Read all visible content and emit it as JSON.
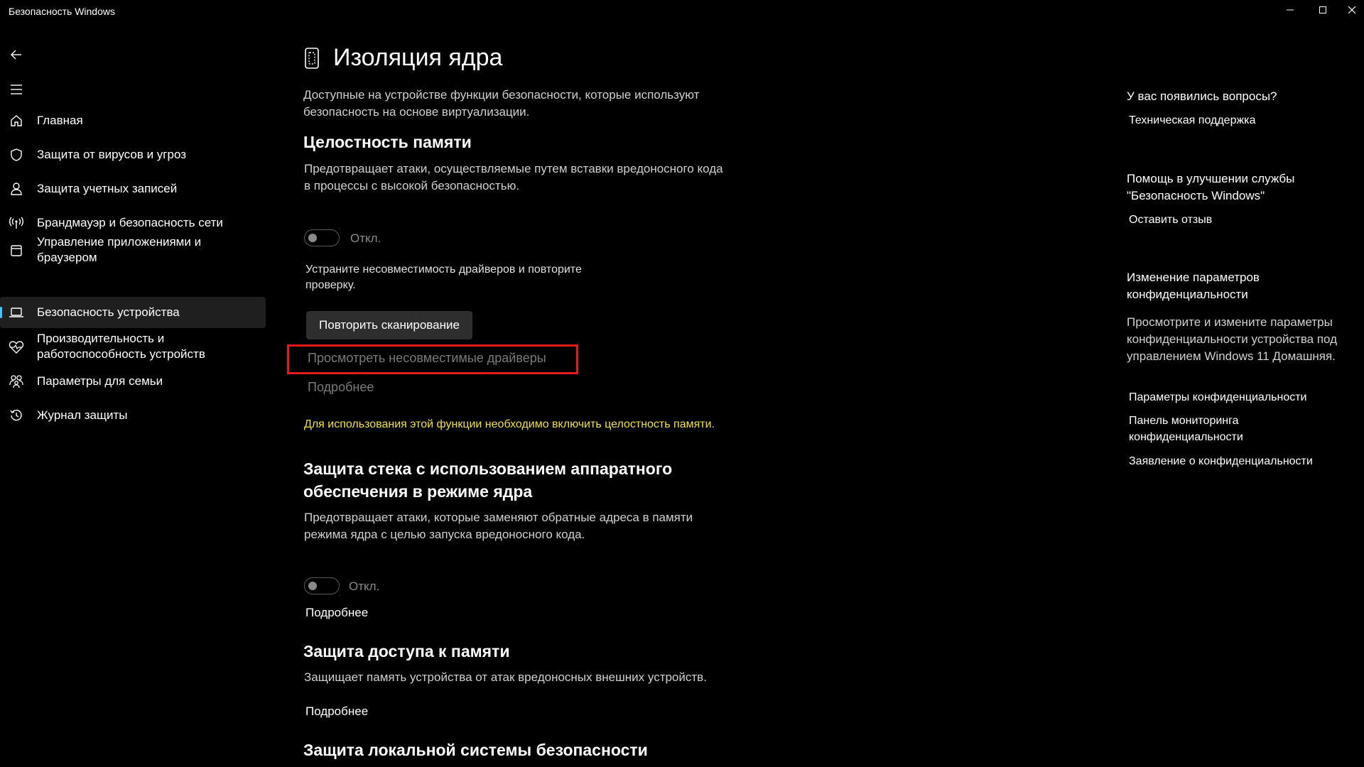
{
  "window": {
    "title": "Безопасность Windows",
    "minimize": "—",
    "maximize": "☐",
    "close": "✕"
  },
  "sidebar": {
    "items": [
      {
        "label": "Главная",
        "icon": "home-icon"
      },
      {
        "label": "Защита от вирусов и угроз",
        "icon": "shield-icon"
      },
      {
        "label": "Защита учетных записей",
        "icon": "person-icon"
      },
      {
        "label": "Брандмауэр и безопасность сети",
        "icon": "wifi-antenna-icon"
      },
      {
        "label": "Управление приложениями и браузером",
        "icon": "app-window-icon"
      },
      {
        "label": "Безопасность устройства",
        "icon": "laptop-icon",
        "active": true
      },
      {
        "label": "Производительность и работоспособность устройств",
        "icon": "heart-pulse-icon"
      },
      {
        "label": "Параметры для семьи",
        "icon": "family-icon"
      },
      {
        "label": "Журнал защиты",
        "icon": "history-icon"
      }
    ]
  },
  "main": {
    "title": "Изоляция ядра",
    "intro": "Доступные на устройстве функции безопасности, которые используют безопасность на основе виртуализации.",
    "memory_integrity": {
      "heading": "Целостность памяти",
      "description": "Предотвращает атаки, осуществляемые путем вставки вредоносного кода в процессы с высокой безопасностью.",
      "toggle_label": "Откл.",
      "fix_text": "Устраните несовместимость драйверов и повторите проверку.",
      "rescan_button": "Повторить сканирование",
      "view_drivers_link": "Просмотреть несовместимые драйверы",
      "more_link": "Подробнее"
    },
    "warning": "Для использования этой функции необходимо включить целостность памяти.",
    "stack_protection": {
      "heading": "Защита стека с использованием аппаратного обеспечения в режиме ядра",
      "description": "Предотвращает атаки, которые заменяют обратные адреса в памяти режима ядра с целью запуска вредоносного кода.",
      "toggle_label": "Откл.",
      "more_link": "Подробнее"
    },
    "memory_access": {
      "heading": "Защита доступа к памяти",
      "description": "Защищает память устройства от атак вредоносных внешних устройств.",
      "more_link": "Подробнее"
    },
    "lsa": {
      "heading": "Защита локальной системы безопасности"
    }
  },
  "right_panel": {
    "questions_heading": "У вас появились вопросы?",
    "support_link": "Техническая поддержка",
    "improve_heading": "Помощь в улучшении службы \"Безопасность Windows\"",
    "feedback_link": "Оставить отзыв",
    "privacy_heading": "Изменение параметров конфиденциальности",
    "privacy_text": "Просмотрите и измените параметры конфиденциальности устройства под управлением Windows 11 Домашняя.",
    "privacy_links": [
      "Параметры конфиденциальности",
      "Панель мониторинга конфиденциальности",
      "Заявление о конфиденциальности"
    ]
  },
  "colors": {
    "background": "#000000",
    "highlight": "#e41b1b",
    "warning": "#f0e046",
    "accent": "#4cc2ff"
  }
}
